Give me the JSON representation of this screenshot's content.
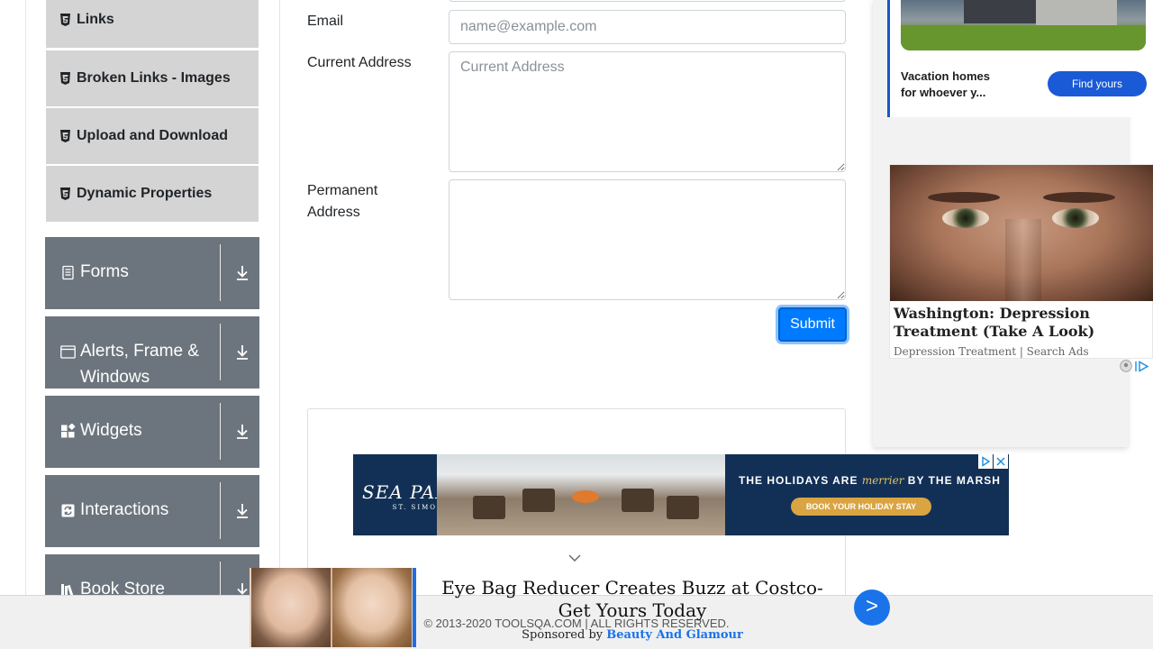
{
  "sidebar": {
    "elements_items": [
      {
        "label": "Links",
        "icon": "html5-icon"
      },
      {
        "label": "Broken Links - Images",
        "icon": "html5-icon"
      },
      {
        "label": "Upload and Download",
        "icon": "html5-icon"
      },
      {
        "label": "Dynamic Properties",
        "icon": "html5-icon"
      }
    ],
    "groups": [
      {
        "label": "Forms",
        "icon": "form-icon"
      },
      {
        "label": "Alerts, Frame &",
        "label2": "Windows",
        "icon": "window-icon"
      },
      {
        "label": "Widgets",
        "icon": "widgets-icon"
      },
      {
        "label": "Interactions",
        "icon": "interactions-icon"
      },
      {
        "label": "Book Store",
        "icon": "book-icon"
      }
    ]
  },
  "form": {
    "email_label": "Email",
    "email_placeholder": "name@example.com",
    "current_address_label": "Current Address",
    "current_address_placeholder": "Current Address",
    "permanent_address_label_line1": "Permanent",
    "permanent_address_label_line2": "Address",
    "submit_label": "Submit"
  },
  "ads": {
    "vacation": {
      "headline_line1": "Vacation homes",
      "headline_line2": "for whoever y...",
      "cta": "Find yours"
    },
    "depression": {
      "title": "Washington: Depression Treatment (Take A Look)",
      "sub": "Depression Treatment | Search Ads"
    },
    "banner": {
      "logo": "SEA PALMS",
      "logo_sub": "ST. SIMONS",
      "tagline_pre": "THE HOLIDAYS ARE",
      "tagline_em": "merrier",
      "tagline_post": "BY THE MARSH",
      "button": "BOOK YOUR HOLIDAY STAY"
    },
    "sticky": {
      "headline": "Eye Bag Reducer Creates Buzz at Costco-Get Yours Today",
      "sponsored_by": "Sponsored by",
      "sponsor": "Beauty And Glamour",
      "go": ">"
    }
  },
  "footer": {
    "copyright": "© 2013-2020 TOOLSQA.COM | ALL RIGHTS RESERVED."
  },
  "colors": {
    "accent": "#007bff",
    "sidebar_group": "#6c757d",
    "sidebar_item": "#d4d4d4"
  }
}
